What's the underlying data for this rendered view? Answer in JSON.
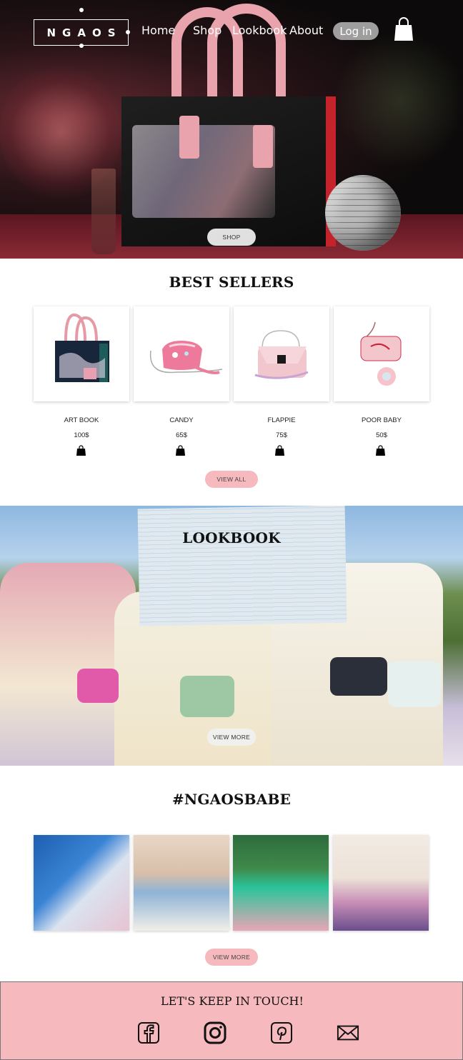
{
  "brand": {
    "logo_text": "NGAOS"
  },
  "nav": {
    "items": [
      {
        "label": "Home"
      },
      {
        "label": "Shop"
      },
      {
        "label": "Lookbook"
      },
      {
        "label": "About"
      }
    ],
    "login_label": "Log in",
    "cart_icon": "shopping-bag-icon"
  },
  "hero": {
    "cta_label": "SHOP"
  },
  "best_sellers": {
    "title": "BEST SELLERS",
    "products": [
      {
        "name": "ART BOOK",
        "price": "100$"
      },
      {
        "name": "CANDY",
        "price": "65$"
      },
      {
        "name": "FLAPPIE",
        "price": "75$"
      },
      {
        "name": "POOR BABY",
        "price": "50$"
      }
    ],
    "view_all_label": "VIEW ALL"
  },
  "lookbook": {
    "title": "LOOKBOOK",
    "cta_label": "VIEW MORE"
  },
  "hashtag": {
    "title": "#NGAOSBABE",
    "cta_label": "VIEW MORE"
  },
  "footer": {
    "title": "LET'S KEEP IN TOUCH!",
    "social_icons": [
      "facebook-icon",
      "instagram-icon",
      "pinterest-icon",
      "mail-icon"
    ]
  },
  "colors": {
    "accent_pink": "#f6b9bd",
    "hero_red": "#c5232c"
  }
}
